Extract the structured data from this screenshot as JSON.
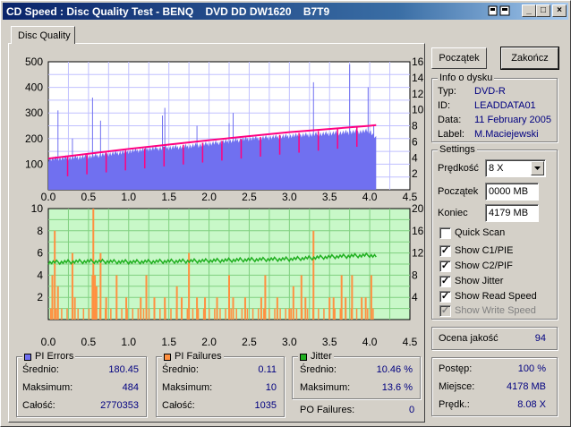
{
  "title": "CD Speed : Disc Quality Test - BENQ    DVD DD DW1620    B7T9",
  "tab_label": "Disc Quality",
  "buttons": {
    "start": "Początek",
    "end": "Zakończ"
  },
  "disc_info": {
    "title": "Info o dysku",
    "type_label": "Typ:",
    "type": "DVD-R",
    "id_label": "ID:",
    "id": "LEADDATA01",
    "date_label": "Data:",
    "date": "11 February 2005",
    "label_label": "Label:",
    "label": "M.Maciejewski"
  },
  "settings": {
    "title": "Settings",
    "speed_label": "Prędkość",
    "speed": "8 X",
    "start_label": "Początek",
    "start": "0000 MB",
    "end_label": "Koniec",
    "end": "4179 MB",
    "quick_scan": "Quick Scan",
    "show_c1": "Show C1/PIE",
    "show_c2": "Show C2/PIF",
    "show_jitter": "Show Jitter",
    "show_read": "Show Read Speed",
    "show_write": "Show Write Speed"
  },
  "quality": {
    "label": "Ocena jakość",
    "value": "94"
  },
  "progress": {
    "progress_label": "Postęp:",
    "progress": "100 %",
    "position_label": "Miejsce:",
    "position": "4178 MB",
    "speed_label": "Prędk.:",
    "speed": "8.08 X"
  },
  "pi_errors": {
    "title": "PI Errors",
    "avg_label": "Średnio:",
    "avg": "180.45",
    "max_label": "Maksimum:",
    "max": "484",
    "total_label": "Całość:",
    "total": "2770353"
  },
  "pi_failures": {
    "title": "PI Failures",
    "avg_label": "Średnio:",
    "avg": "0.11",
    "max_label": "Maksimum:",
    "max": "10",
    "total_label": "Całość:",
    "total": "1035"
  },
  "jitter": {
    "title": "Jitter",
    "avg_label": "Średnio:",
    "avg": "10.46 %",
    "max_label": "Maksimum:",
    "max": "13.6 %"
  },
  "po_failures": {
    "label": "PO Failures:",
    "value": "0"
  },
  "colors": {
    "pi_errors": "#7070f0",
    "pi_failures": "#ff9040",
    "jitter": "#20b020",
    "read_speed": "#ff0080",
    "chart_bg_bottom": "#c8f8c8"
  },
  "chart_data": [
    {
      "type": "bar",
      "x_ticks": [
        "0.0",
        "0.5",
        "1.0",
        "1.5",
        "2.0",
        "2.5",
        "3.0",
        "3.5",
        "4.0",
        "4.5"
      ],
      "xlim": [
        0,
        4.5
      ],
      "y_left_ticks": [
        "100",
        "200",
        "300",
        "400",
        "500"
      ],
      "ylim_left": [
        0,
        500
      ],
      "y_right_ticks": [
        "2",
        "4",
        "6",
        "8",
        "10",
        "12",
        "14",
        "16"
      ],
      "ylim_right": [
        0,
        16
      ],
      "grid": true,
      "series": [
        {
          "values_note": "pie",
          "x": [
            0.0,
            0.25,
            0.5,
            0.75,
            1.0,
            1.25,
            1.5,
            1.75,
            2.0,
            2.25,
            2.5,
            2.75,
            3.0,
            3.25,
            3.5,
            3.75,
            4.0,
            4.08
          ],
          "y": [
            120,
            125,
            130,
            140,
            150,
            160,
            165,
            170,
            180,
            190,
            200,
            205,
            210,
            215,
            220,
            225,
            230,
            200
          ]
        },
        {
          "values_note": "speed",
          "x": [
            0.0,
            1.0,
            2.0,
            3.0,
            4.0,
            4.08
          ],
          "y": [
            3.9,
            5.1,
            6.2,
            7.2,
            8.0,
            8.08
          ]
        }
      ],
      "spikes": [
        [
          0.12,
          310
        ],
        [
          0.3,
          200
        ],
        [
          0.55,
          360
        ],
        [
          0.65,
          270
        ],
        [
          1.42,
          290
        ],
        [
          1.45,
          320
        ],
        [
          1.85,
          250
        ],
        [
          2.25,
          260
        ],
        [
          2.3,
          300
        ],
        [
          3.3,
          420
        ],
        [
          3.75,
          490
        ],
        [
          3.98,
          400
        ],
        [
          4.05,
          250
        ]
      ]
    },
    {
      "type": "bar",
      "x_ticks": [
        "0.0",
        "0.5",
        "1.0",
        "1.5",
        "2.0",
        "2.5",
        "3.0",
        "3.5",
        "4.0",
        "4.5"
      ],
      "xlim": [
        0,
        4.5
      ],
      "y_left_ticks": [
        "2",
        "4",
        "6",
        "8",
        "10"
      ],
      "ylim_left": [
        0,
        10
      ],
      "y_right_ticks": [
        "4",
        "8",
        "12",
        "16",
        "20"
      ],
      "ylim_right": [
        0,
        20
      ],
      "grid": true,
      "series": [
        {
          "values_note": "pif",
          "x": [
            0.05,
            0.08,
            0.12,
            0.3,
            0.33,
            0.55,
            0.56,
            0.58,
            0.6,
            0.65,
            0.72,
            0.85,
            0.97,
            1.15,
            1.22,
            1.32,
            1.45,
            1.6,
            1.66,
            1.75,
            1.85,
            1.95,
            2.1,
            2.25,
            2.3,
            2.45,
            2.65,
            2.7,
            2.85,
            3.0,
            3.05,
            3.15,
            3.2,
            3.3,
            3.5,
            3.55,
            3.65,
            3.7,
            3.78,
            3.9,
            3.95,
            4.02
          ],
          "y": [
            4,
            8,
            3,
            6,
            2,
            4,
            10,
            4,
            3,
            6,
            2,
            4,
            2,
            2,
            4,
            2,
            2,
            3,
            2,
            6,
            2,
            2,
            2,
            4,
            2,
            2,
            2,
            4,
            2,
            1,
            3,
            4,
            2,
            8,
            2,
            2,
            4,
            2,
            4,
            2,
            2,
            4
          ]
        },
        {
          "values_note": "jitter",
          "x": [
            0.0,
            0.5,
            1.0,
            1.5,
            2.0,
            2.5,
            3.0,
            3.5,
            4.0,
            4.08
          ],
          "y": [
            10.3,
            10.5,
            10.4,
            10.5,
            10.6,
            10.8,
            10.9,
            11.3,
            11.6,
            11.4
          ]
        }
      ]
    }
  ]
}
